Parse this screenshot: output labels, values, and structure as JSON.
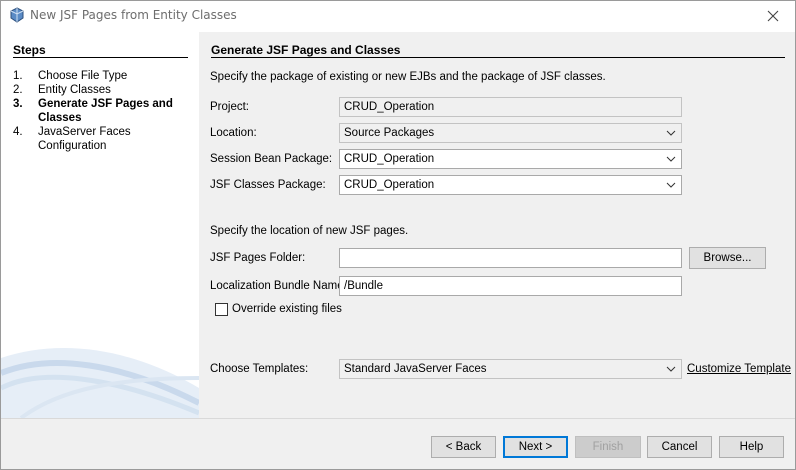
{
  "window": {
    "title": "New JSF Pages from Entity Classes"
  },
  "steps": {
    "title": "Steps",
    "items": [
      {
        "num": "1.",
        "label": "Choose File Type"
      },
      {
        "num": "2.",
        "label": "Entity Classes"
      },
      {
        "num": "3.",
        "label": "Generate JSF Pages and Classes"
      },
      {
        "num": "4.",
        "label": "JavaServer Faces Configuration"
      }
    ]
  },
  "main": {
    "title": "Generate JSF Pages and Classes",
    "intro": "Specify the package of existing or new EJBs and the package of JSF classes.",
    "project_label": "Project:",
    "project_value": "CRUD_Operation",
    "location_label": "Location:",
    "location_value": "Source Packages",
    "session_label": "Session Bean Package:",
    "session_value": "CRUD_Operation",
    "jsfclasses_label": "JSF Classes Package:",
    "jsfclasses_value": "CRUD_Operation",
    "pages_intro": "Specify the location of new JSF pages.",
    "pages_folder_label": "JSF Pages Folder:",
    "pages_folder_value": "",
    "browse_label": "Browse...",
    "bundle_label": "Localization Bundle Name:",
    "bundle_value": "/Bundle",
    "override_label": "Override existing files",
    "templates_label": "Choose Templates:",
    "templates_value": "Standard JavaServer Faces",
    "customize_label": "Customize Template"
  },
  "footer": {
    "back_label": "< Back",
    "next_label": "Next >",
    "finish_label": "Finish",
    "cancel_label": "Cancel",
    "help_label": "Help"
  },
  "colors": {
    "accent": "#0078d7",
    "panel": "#f0f0f0"
  }
}
